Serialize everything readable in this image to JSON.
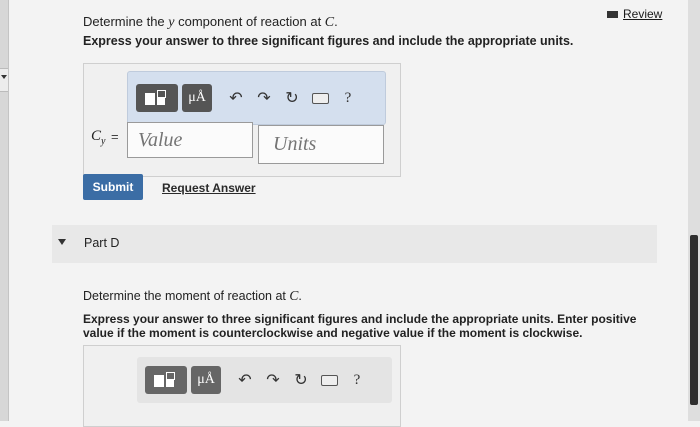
{
  "header": {
    "review_label": "Review"
  },
  "question": {
    "prefix": "Determine the ",
    "symbol": "y",
    "middle": " component of reaction at ",
    "point": "C",
    "suffix": ".",
    "instruction": "Express your answer to three significant figures and include the appropriate units."
  },
  "toolbar": {
    "mu_label": "μÅ",
    "help_label": "?"
  },
  "answer": {
    "var_main": "C",
    "var_sub": "y",
    "equals": "=",
    "value_placeholder": "Value",
    "units_placeholder": "Units"
  },
  "actions": {
    "submit_label": "Submit",
    "request_label": "Request Answer"
  },
  "part_d": {
    "label": "Part D",
    "question_prefix": "Determine the moment of reaction at ",
    "question_point": "C",
    "question_suffix": ".",
    "instruction": "Express your answer to three significant figures and include the appropriate units. Enter positive value if the moment is counterclockwise and negative value if the moment is clockwise."
  },
  "icons": [
    "template-icon",
    "mu-angstrom-icon",
    "undo-icon",
    "redo-icon",
    "reset-icon",
    "keyboard-icon",
    "help-icon",
    "review-icon",
    "caret-down-icon"
  ]
}
